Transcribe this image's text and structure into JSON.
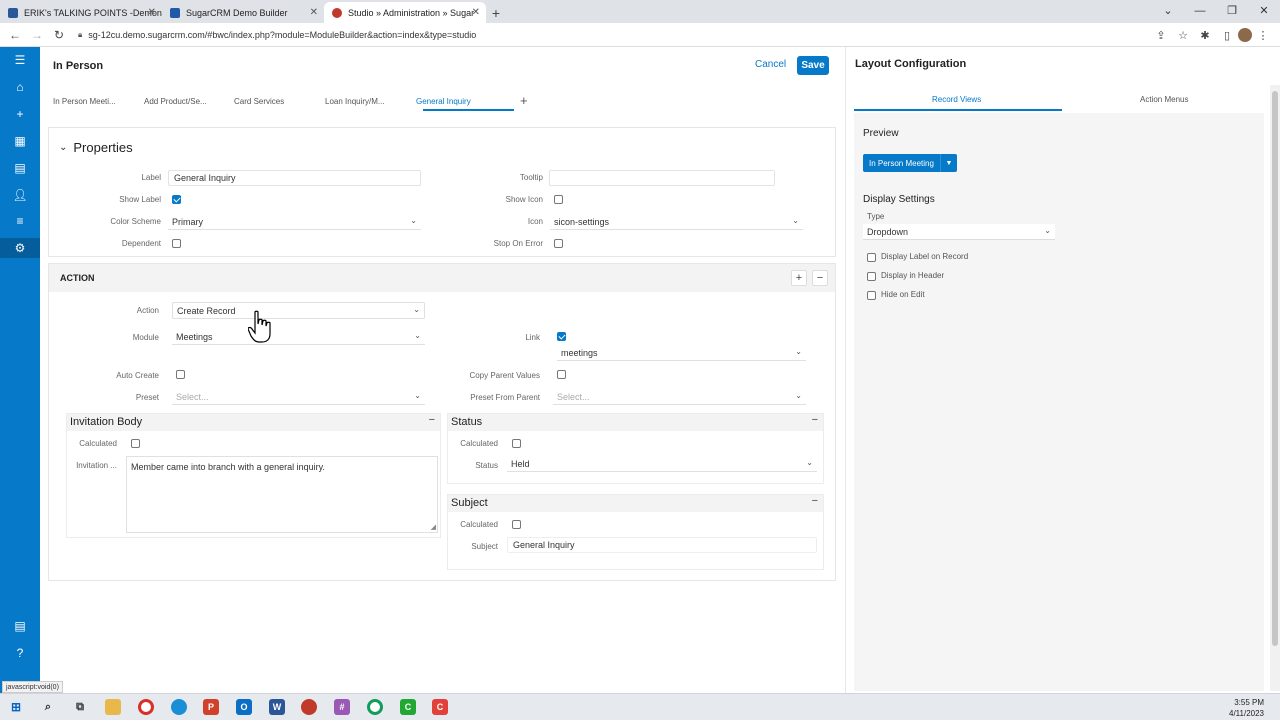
{
  "browser": {
    "tabs": [
      {
        "title": "ERIK's TALKING POINTS -Demon",
        "color": "#2b579a"
      },
      {
        "title": "SugarCRM Demo Builder",
        "color": "#1f5aa6"
      },
      {
        "title": "Studio » Administration » Sugar",
        "color": "#c0392b"
      }
    ],
    "new_tab_label": "+",
    "url": "sg-12cu.demo.sugarcrm.com/#bwc/index.php?module=ModuleBuilder&action=index&type=studio"
  },
  "header": {
    "title": "In Person",
    "cancel_label": "Cancel",
    "save_label": "Save"
  },
  "config_tabs": [
    {
      "label": "In Person Meeti..."
    },
    {
      "label": "Add Product/Se..."
    },
    {
      "label": "Card Services"
    },
    {
      "label": "Loan Inquiry/M..."
    },
    {
      "label": "General Inquiry"
    }
  ],
  "properties": {
    "heading": "Properties",
    "label_label": "Label",
    "label_value": "General Inquiry",
    "tooltip_label": "Tooltip",
    "tooltip_value": "",
    "show_label_label": "Show Label",
    "show_icon_label": "Show Icon",
    "color_scheme_label": "Color Scheme",
    "color_scheme_value": "Primary",
    "icon_label": "Icon",
    "icon_value": "sicon-settings",
    "dependent_label": "Dependent",
    "stop_on_error_label": "Stop On Error"
  },
  "action": {
    "heading": "ACTION",
    "action_label": "Action",
    "action_value": "Create Record",
    "module_label": "Module",
    "module_value": "Meetings",
    "link_label": "Link",
    "link_value": "meetings",
    "auto_create_label": "Auto Create",
    "copy_parent_label": "Copy Parent Values",
    "preset_label": "Preset",
    "preset_placeholder": "Select...",
    "preset_parent_label": "Preset From Parent",
    "preset_parent_placeholder": "Select..."
  },
  "invitation": {
    "heading": "Invitation Body",
    "calculated_label": "Calculated",
    "field_label": "Invitation ...",
    "body_value": "Member came into branch with a general inquiry."
  },
  "status": {
    "heading": "Status",
    "calculated_label": "Calculated",
    "status_label": "Status",
    "status_value": "Held"
  },
  "subject": {
    "heading": "Subject",
    "calculated_label": "Calculated",
    "subject_label": "Subject",
    "subject_value": "General Inquiry"
  },
  "layout_config": {
    "title": "Layout Configuration",
    "tab_record_views": "Record Views",
    "tab_action_menus": "Action Menus",
    "preview_label": "Preview",
    "preview_button": "In Person Meeting",
    "display_settings_label": "Display Settings",
    "type_label": "Type",
    "type_value": "Dropdown",
    "opt_display_label": "Display Label on Record",
    "opt_display_header": "Display in Header",
    "opt_hide_edit": "Hide on Edit"
  },
  "status_tip": "javascript:void(0)",
  "clock": {
    "time": "3:55 PM",
    "date": "4/11/2023"
  },
  "colors": {
    "accent": "#0679c8",
    "sidebar": "#0679c8"
  }
}
